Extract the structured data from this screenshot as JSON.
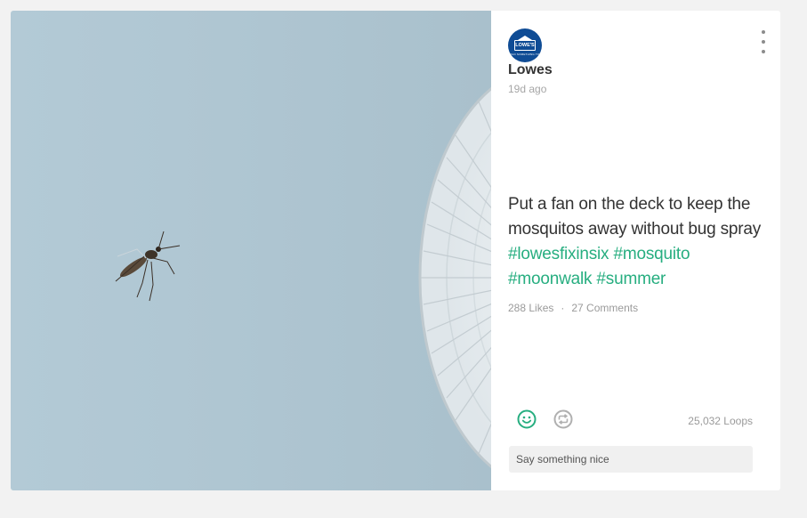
{
  "post": {
    "author": {
      "name": "Lowes",
      "avatar_logo_text": "LOWE'S",
      "avatar_logo_subtext": "LET'S BUILD SOMETHING TOGETHER"
    },
    "time_ago": "19d ago",
    "caption": {
      "text": "Put a fan on the deck to keep the mosquitos away without bug spray",
      "hashtags": [
        "#lowesfixinsix",
        "#mosquito",
        "#moonwalk",
        "#summer"
      ]
    },
    "likes": "288 Likes",
    "separator": "·",
    "comments": "27 Comments",
    "loops": "25,032 Loops",
    "comment_placeholder": "Say something nice",
    "icons": {
      "more": "vertical-dots-icon",
      "like": "smiley-icon",
      "revine": "revine-icon"
    },
    "colors": {
      "accent": "#27ae80",
      "brand": "#0f4c95",
      "text": "#333333",
      "muted": "#9a9a9a"
    }
  }
}
